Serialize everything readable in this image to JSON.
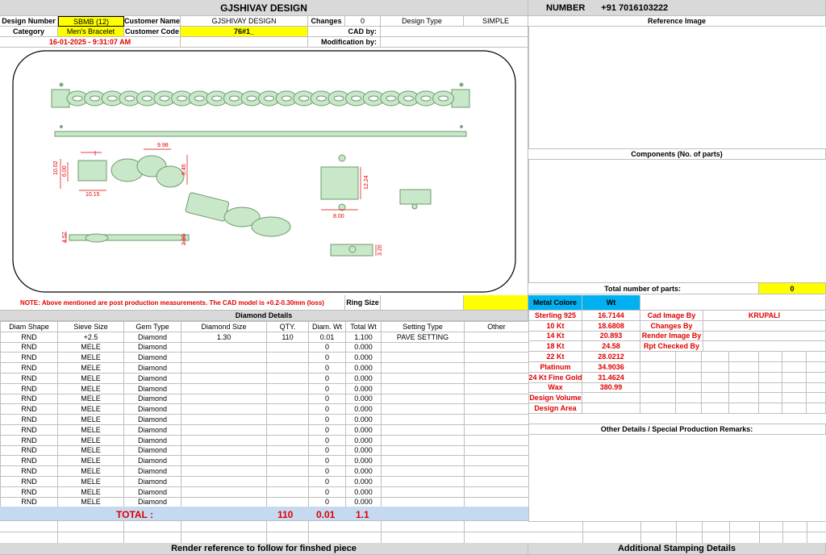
{
  "header": {
    "company": "GJSHIVAY DESIGN",
    "number_label": "NUMBER",
    "number_value": "+91 7016103222"
  },
  "info": {
    "design_number_label": "Design Number",
    "design_number": "SBMB (12)",
    "customer_name_label": "Customer Name",
    "customer_name": "GJSHIVAY DESIGN",
    "changes_label": "Changes",
    "changes": "0",
    "design_type_label": "Design Type",
    "design_type": "SIMPLE",
    "category_label": "Category",
    "category": "Men's Bracelet",
    "customer_code_label": "Customer Code",
    "customer_code": "76#1_",
    "cad_by_label": "CAD by:",
    "timestamp": "16-01-2025 - 9:31:07 AM",
    "modification_by_label": "Modification by:"
  },
  "drawing": {
    "dims": [
      "9.98",
      "10.02",
      "6.00",
      "8.45",
      "10.15",
      "12.24",
      "8.00",
      "4.52",
      "2.90",
      "3.20"
    ]
  },
  "right_panel": {
    "reference_image": "Reference Image",
    "components": "Components (No. of parts)",
    "total_parts_label": "Total number of parts:",
    "total_parts": "0",
    "other_details": "Other Details / Special Production Remarks:",
    "stamping": "Additional Stamping Details"
  },
  "note": "NOTE: Above mentioned are post production measurements. The CAD model is +0.2-0.30mm (loss)",
  "ring_size_label": "Ring Size",
  "metal": {
    "header_metal": "Metal Colore",
    "header_wt": "Wt",
    "rows": [
      {
        "name": "Sterling 925",
        "wt": "16.7144"
      },
      {
        "name": "10 Kt",
        "wt": "18.6808"
      },
      {
        "name": "14 Kt",
        "wt": "20.893"
      },
      {
        "name": "18 Kt",
        "wt": "24.58"
      },
      {
        "name": "22 Kt",
        "wt": "28.0212"
      },
      {
        "name": "Platinum",
        "wt": "34.9036"
      },
      {
        "name": "24 Kt Fine Gold",
        "wt": "31.4624"
      },
      {
        "name": "Wax",
        "wt": "380.99"
      },
      {
        "name": "Design Volume",
        "wt": ""
      },
      {
        "name": "Design Area",
        "wt": ""
      }
    ]
  },
  "staff": {
    "rows": [
      {
        "label": "Cad Image By",
        "value": "KRUPALI"
      },
      {
        "label": "Changes By",
        "value": ""
      },
      {
        "label": "Render Image By",
        "value": ""
      },
      {
        "label": "Rpt Checked By",
        "value": ""
      }
    ]
  },
  "diamond": {
    "title": "Diamond Details",
    "headers": [
      "Diam Shape",
      "Sieve Size",
      "Gem Type",
      "Diamond Size",
      "QTY.",
      "Diam. Wt",
      "Total Wt",
      "Setting Type",
      "Other"
    ],
    "rows": [
      [
        "RND",
        "+2.5",
        "Diamond",
        "1.30",
        "110",
        "0.01",
        "1.100",
        "PAVE SETTING",
        ""
      ],
      [
        "RND",
        "MELE",
        "Diamond",
        "",
        "",
        "0",
        "0.000",
        "",
        ""
      ],
      [
        "RND",
        "MELE",
        "Diamond",
        "",
        "",
        "0",
        "0.000",
        "",
        ""
      ],
      [
        "RND",
        "MELE",
        "Diamond",
        "",
        "",
        "0",
        "0.000",
        "",
        ""
      ],
      [
        "RND",
        "MELE",
        "Diamond",
        "",
        "",
        "0",
        "0.000",
        "",
        ""
      ],
      [
        "RND",
        "MELE",
        "Diamond",
        "",
        "",
        "0",
        "0.000",
        "",
        ""
      ],
      [
        "RND",
        "MELE",
        "Diamond",
        "",
        "",
        "0",
        "0.000",
        "",
        ""
      ],
      [
        "RND",
        "MELE",
        "Diamond",
        "",
        "",
        "0",
        "0.000",
        "",
        ""
      ],
      [
        "RND",
        "MELE",
        "Diamond",
        "",
        "",
        "0",
        "0.000",
        "",
        ""
      ],
      [
        "RND",
        "MELE",
        "Diamond",
        "",
        "",
        "0",
        "0.000",
        "",
        ""
      ],
      [
        "RND",
        "MELE",
        "Diamond",
        "",
        "",
        "0",
        "0.000",
        "",
        ""
      ],
      [
        "RND",
        "MELE",
        "Diamond",
        "",
        "",
        "0",
        "0.000",
        "",
        ""
      ],
      [
        "RND",
        "MELE",
        "Diamond",
        "",
        "",
        "0",
        "0.000",
        "",
        ""
      ],
      [
        "RND",
        "MELE",
        "Diamond",
        "",
        "",
        "0",
        "0.000",
        "",
        ""
      ],
      [
        "RND",
        "MELE",
        "Diamond",
        "",
        "",
        "0",
        "0.000",
        "",
        ""
      ],
      [
        "RND",
        "MELE",
        "Diamond",
        "",
        "",
        "0",
        "0.000",
        "",
        ""
      ],
      [
        "RND",
        "MELE",
        "Diamond",
        "",
        "",
        "0",
        "0.000",
        "",
        ""
      ]
    ],
    "total_label": "TOTAL :",
    "total_qty": "110",
    "total_diam_wt": "0.01",
    "total_wt": "1.1"
  },
  "footer": {
    "render_note": "Render reference to follow for finshed piece"
  }
}
